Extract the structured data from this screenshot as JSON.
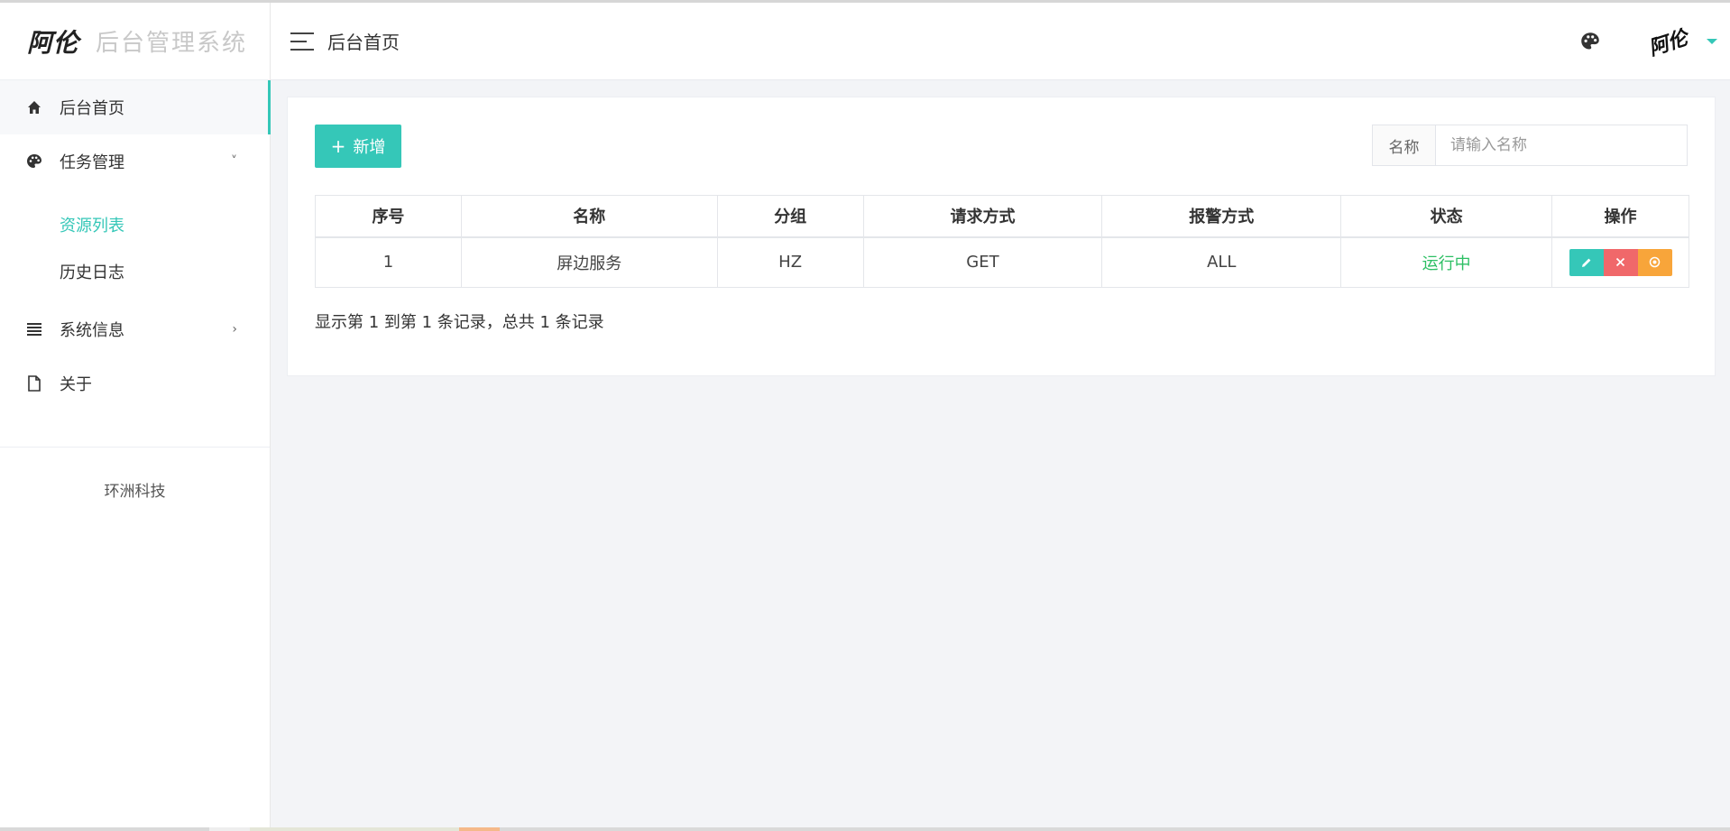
{
  "sidebar": {
    "logo_mark": "阿伦",
    "logo_text": "后台管理系统",
    "items": [
      {
        "label": "后台首页",
        "icon": "home-icon"
      },
      {
        "label": "任务管理",
        "icon": "palette-icon",
        "arrow": "˅"
      },
      {
        "label": "系统信息",
        "icon": "list-icon",
        "arrow": "›"
      },
      {
        "label": "关于",
        "icon": "document-icon"
      }
    ],
    "sub_items": [
      {
        "label": "资源列表"
      },
      {
        "label": "历史日志"
      }
    ],
    "company": "环洲科技"
  },
  "header": {
    "title": "后台首页",
    "avatar_text": "阿伦",
    "palette_icon": "palette-icon"
  },
  "toolbar": {
    "add_label": "新增",
    "add_icon": "plus-icon"
  },
  "search": {
    "label": "名称",
    "placeholder": "请输入名称"
  },
  "table": {
    "headers": [
      "序号",
      "名称",
      "分组",
      "请求方式",
      "报警方式",
      "状态",
      "操作"
    ],
    "rows": [
      {
        "seq": "1",
        "name": "屏边服务",
        "group": "HZ",
        "method": "GET",
        "alarm": "ALL",
        "status": "运行中"
      }
    ]
  },
  "pager": {
    "text": "显示第 1 到第 1 条记录，总共 1 条记录"
  },
  "colors": {
    "accent": "#35c7b8",
    "danger": "#f0686a",
    "warning": "#f8a53a",
    "success": "#2dbf64"
  }
}
